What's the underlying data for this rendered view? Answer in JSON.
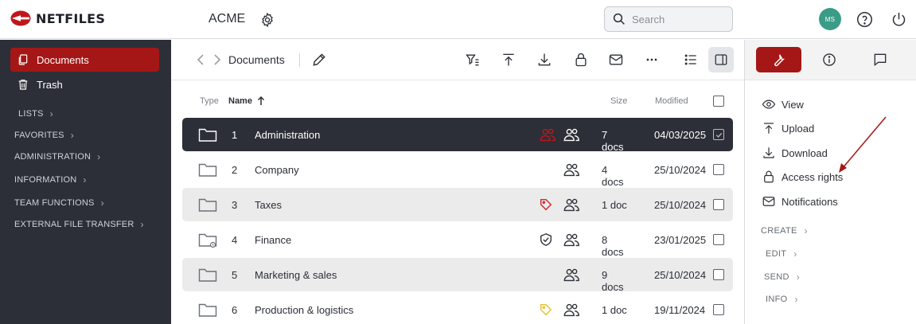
{
  "app": {
    "brand": "NETFILES",
    "org": "ACME"
  },
  "search": {
    "placeholder": "Search"
  },
  "user": {
    "initials": "MS"
  },
  "sidebar": {
    "items": [
      {
        "label": "Documents",
        "active": true
      },
      {
        "label": "Trash",
        "active": false
      }
    ],
    "sections": [
      "LISTS",
      "FAVORITES",
      "ADMINISTRATION",
      "INFORMATION",
      "TEAM FUNCTIONS",
      "EXTERNAL FILE TRANSFER"
    ]
  },
  "toolbar": {
    "breadcrumb": "Documents"
  },
  "table": {
    "headers": {
      "type": "Type",
      "name": "Name",
      "size": "Size",
      "modified": "Modified"
    },
    "rows": [
      {
        "num": "1",
        "name": "Administration",
        "size": "7 docs",
        "modified": "04/03/2025",
        "state": "selected",
        "badges": [
          "people-red-icon",
          "people-icon"
        ]
      },
      {
        "num": "2",
        "name": "Company",
        "size": "4 docs",
        "modified": "25/10/2024",
        "state": "plain",
        "badges": [
          "people-icon"
        ]
      },
      {
        "num": "3",
        "name": "Taxes",
        "size": "1 doc",
        "modified": "25/10/2024",
        "state": "shaded",
        "badges": [
          "tag-red-icon",
          "people-icon"
        ]
      },
      {
        "num": "4",
        "name": "Finance",
        "size": "8 docs",
        "modified": "23/01/2025",
        "state": "plain",
        "badges": [
          "shield-check-icon",
          "people-icon"
        ]
      },
      {
        "num": "5",
        "name": "Marketing & sales",
        "size": "9 docs",
        "modified": "25/10/2024",
        "state": "shaded",
        "badges": [
          "people-icon"
        ]
      },
      {
        "num": "6",
        "name": "Production & logistics",
        "size": "1 doc",
        "modified": "19/11/2024",
        "state": "plain",
        "badges": [
          "tag-yellow-icon",
          "people-icon"
        ]
      }
    ]
  },
  "panel": {
    "actions": [
      {
        "label": "View",
        "icon": "eye-icon"
      },
      {
        "label": "Upload",
        "icon": "upload-icon"
      },
      {
        "label": "Download",
        "icon": "download-icon"
      },
      {
        "label": "Access rights",
        "icon": "lock-icon"
      },
      {
        "label": "Notifications",
        "icon": "envelope-icon"
      }
    ],
    "sections": [
      "CREATE",
      "EDIT",
      "SEND",
      "INFO"
    ]
  },
  "colors": {
    "accent": "#a51716",
    "sidebar": "#2c2f38",
    "avatar": "#3a9c87",
    "arrow": "#a51716"
  }
}
